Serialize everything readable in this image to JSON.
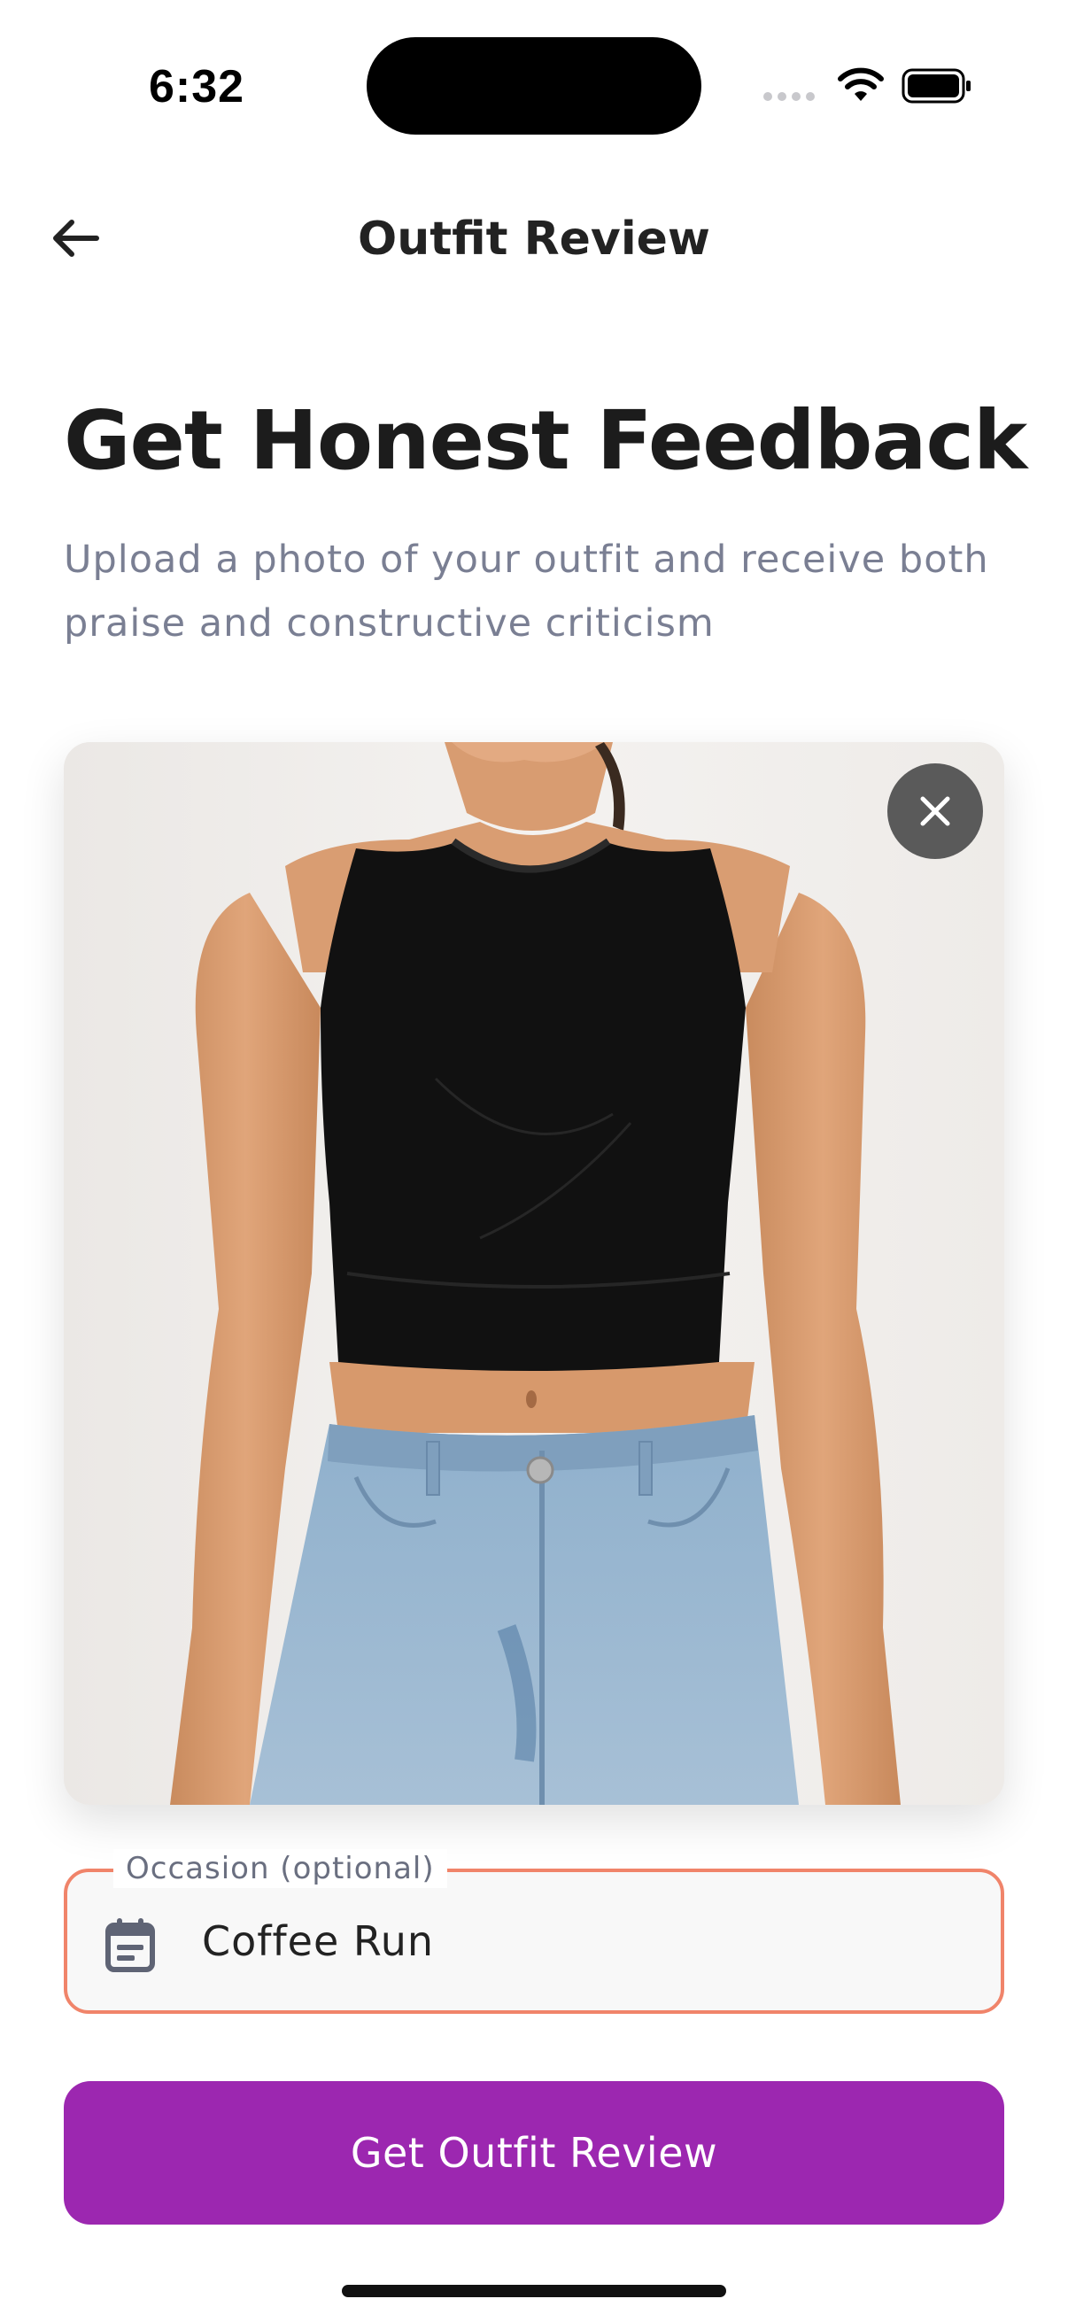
{
  "status_bar": {
    "time": "6:32"
  },
  "header": {
    "title": "Outfit Review",
    "back_icon": "arrow-left-icon"
  },
  "hero": {
    "headline": "Get Honest Feedback",
    "subtitle": "Upload a photo of your outfit and receive both praise and constructive criticism"
  },
  "photo": {
    "description_icon": "outfit-photo",
    "remove_icon": "close-icon"
  },
  "occasion": {
    "label": "Occasion (optional)",
    "value": "Coffee Run",
    "icon": "calendar-icon"
  },
  "cta": {
    "label": "Get Outfit Review"
  },
  "colors": {
    "accent": "#9c27b0",
    "field_border": "#f0846a",
    "subtitle_text": "#7a7f93"
  }
}
